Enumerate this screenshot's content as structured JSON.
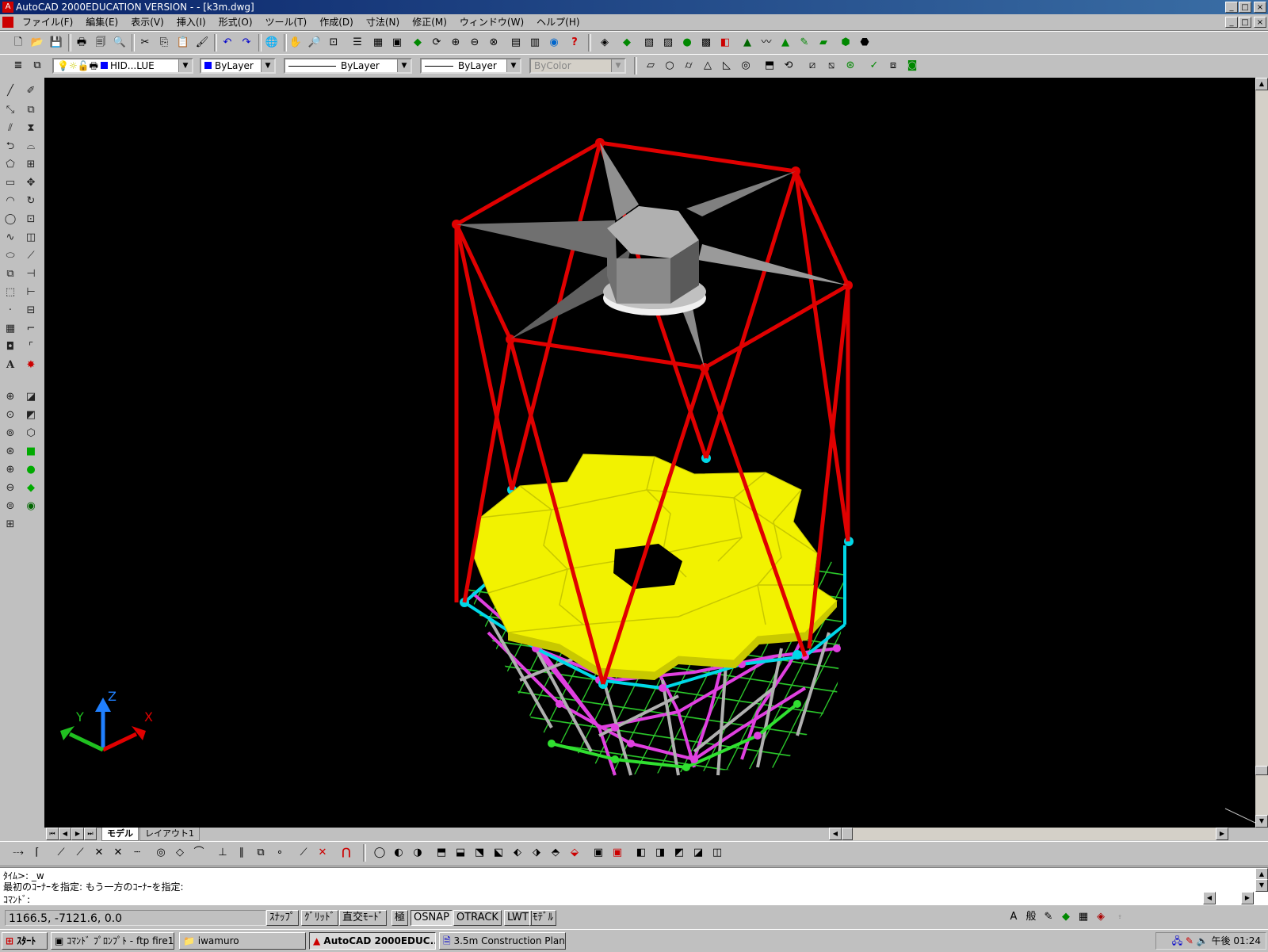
{
  "title_bar": {
    "title": "AutoCAD 2000EDUCATION VERSION - - [k3m.dwg]"
  },
  "menu": [
    "ファイル(F)",
    "編集(E)",
    "表示(V)",
    "挿入(I)",
    "形式(O)",
    "ツール(T)",
    "作成(D)",
    "寸法(N)",
    "修正(M)",
    "ウィンドウ(W)",
    "ヘルプ(H)"
  ],
  "properties_bar": {
    "layer": "HID...LUE",
    "color": "ByLayer",
    "linetype": "ByLayer",
    "lineweight": "ByLayer",
    "plotstyle": "ByColor"
  },
  "colors": {
    "frame": "#e00000",
    "mirror": "#f2f200",
    "cyan_strut": "#00d8e8",
    "magenta_strut": "#e040e0",
    "green_strut": "#30e030",
    "grey_strut": "#b0b0b0",
    "viewport_bg": "#000000"
  },
  "ucs": {
    "x": "X",
    "y": "Y",
    "z": "Z"
  },
  "layout_tabs": {
    "model": "モデル",
    "layout1": "レイアウト1"
  },
  "command": {
    "line1": "ﾀｲﾑ>:  _w",
    "line2": "最初のｺｰﾅｰを指定: もう一方のｺｰﾅｰを指定:",
    "prompt": "ｺﾏﾝﾄﾞ:"
  },
  "status": {
    "coords": "1166.5,  -7121.6, 0.0",
    "buttons": [
      "ｽﾅｯﾌﾟ",
      "ｸﾞﾘｯﾄﾞ",
      "直交ﾓｰﾄﾞ",
      "極",
      "OSNAP",
      "OTRACK",
      "LWT",
      "ﾓﾃﾞﾙ"
    ]
  },
  "taskbar": {
    "start": "ｽﾀｰﾄ",
    "tasks": [
      "ｺﾏﾝﾄﾞ ﾌﾟﾛﾝﾌﾟﾄ - ftp fire1",
      "iwamuro",
      "AutoCAD 2000EDUC...",
      "3.5m Construction Plan -..."
    ],
    "clock": "午後 01:24"
  }
}
